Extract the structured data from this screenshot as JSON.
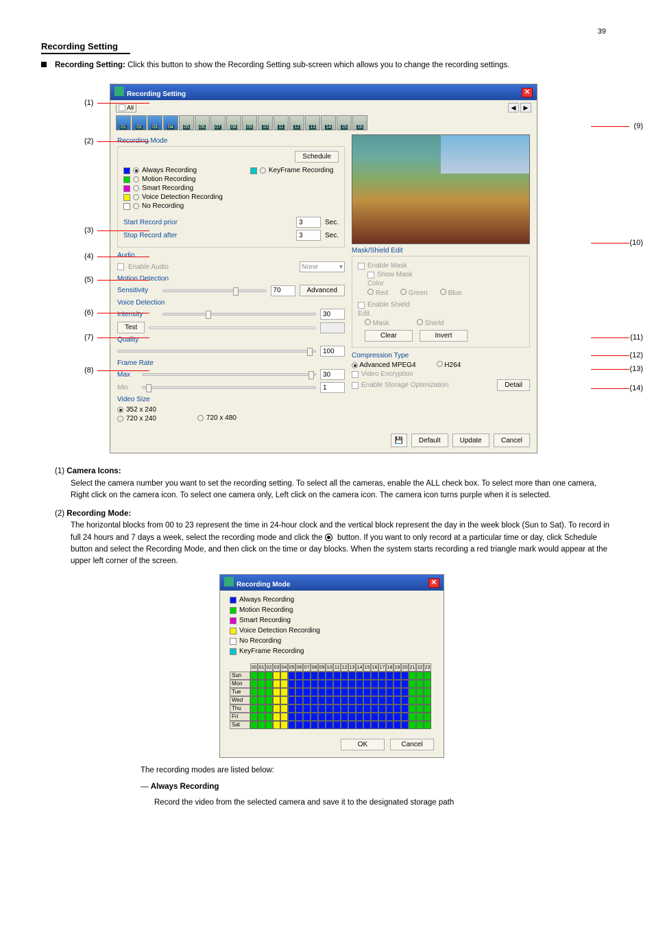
{
  "page_number": "39",
  "heading": "Recording Setting",
  "intro_label": "Recording Setting:",
  "intro_text": "Click this button to show the Recording Setting sub-screen which allows you to change the recording settings.",
  "dialog": {
    "title": "Recording Setting",
    "all": "All",
    "camera_tabs": [
      "01",
      "02",
      "03",
      "04",
      "05",
      "06",
      "07",
      "08",
      "09",
      "10",
      "11",
      "12",
      "13",
      "14",
      "15",
      "16"
    ],
    "recording_mode": {
      "title": "Recording Mode",
      "schedule_btn": "Schedule",
      "options": [
        {
          "label": "Always Recording",
          "color": "#0018f0",
          "checked": true
        },
        {
          "label": "KeyFrame Recording",
          "color": "#00c8c8",
          "checked": false,
          "right": true
        },
        {
          "label": "Motion Recording",
          "color": "#00d000",
          "checked": false
        },
        {
          "label": "Smart Recording",
          "color": "#e000d0",
          "checked": false
        },
        {
          "label": "Voice Detection Recording",
          "color": "#f8f000",
          "checked": false
        },
        {
          "label": "No Recording",
          "color": "#ffffff",
          "checked": false
        }
      ],
      "start_prior_label": "Start Record prior",
      "start_prior_val": "3",
      "sec": "Sec.",
      "stop_after_label": "Stop Record after",
      "stop_after_val": "3"
    },
    "audio": {
      "title": "Audio",
      "enable": "Enable Audio",
      "dropdown": "None"
    },
    "motion": {
      "title": "Motion Detection",
      "sens_label": "Sensitivity",
      "sens_val": "70",
      "adv": "Advanced"
    },
    "voice": {
      "title": "Voice Detection",
      "intensity_label": "Intensity",
      "intensity_val": "30",
      "test": "Test"
    },
    "quality": {
      "title": "Quality",
      "val": "100"
    },
    "framerate": {
      "title": "Frame Rate",
      "max": "Max",
      "max_val": "30",
      "min": "Min",
      "min_val": "1"
    },
    "videosize": {
      "title": "Video Size",
      "o1": "352 x 240",
      "o2": "720 x 240",
      "o3": "720 x 480"
    },
    "maskshield": {
      "title": "Mask/Shield Edit",
      "enable_mask": "Enable Mask",
      "show_mask": "Show Mask",
      "color": "Color",
      "red": "Red",
      "green": "Green",
      "blue": "Blue",
      "enable_shield": "Enable Shield",
      "edit": "Edit",
      "mask": "Mask",
      "shield": "Shield",
      "clear": "Clear",
      "invert": "Invert"
    },
    "compression": {
      "title": "Compression Type",
      "mpeg4": "Advanced MPEG4",
      "h264": "H264",
      "video_enc": "Video Encryption",
      "storage_opt": "Enable Storage Optimization",
      "detail": "Detail"
    },
    "buttons": {
      "default": "Default",
      "update": "Update",
      "cancel": "Cancel"
    }
  },
  "callouts": [
    "(1)",
    "(2)",
    "(3)",
    "(4)",
    "(5)",
    "(6)",
    "(7)",
    "(8)",
    "(9)",
    "(10)",
    "(11)",
    "(12)",
    "(13)",
    "(14)"
  ],
  "section1_num": "(1)",
  "section1_title": "Camera Icons:",
  "section1_text": "Select the camera number you want to set the recording setting. To select all the cameras, enable the ALL check box. To select more than one camera, Right click on the camera icon. To select one camera only, Left click on the camera icon. The camera icon turns purple when it is selected.",
  "section2_num": "(2)",
  "section2_title": "Recording Mode:",
  "section2_text": "The horizontal blocks from 00 to 23 represent the time in 24-hour clock and the vertical block represent the day in the week block (Sun to Sat). To record in full 24 hours and 7 days a week, select the recording mode and click the",
  "section2_text2": "button. If you want to only record at a particular time or day, click Schedule button and select the Recording Mode, and then click on the time or day blocks. When the system starts recording a red triangle mark would appear at the upper left corner of the screen.",
  "sched": {
    "title": "Recording Mode",
    "legend": [
      {
        "label": "Always Recording",
        "color": "#0018f0"
      },
      {
        "label": "Motion Recording",
        "color": "#00d000"
      },
      {
        "label": "Smart Recording",
        "color": "#e000d0"
      },
      {
        "label": "Voice Detection Recording",
        "color": "#f8f000"
      },
      {
        "label": "No Recording",
        "color": "#ffffff"
      },
      {
        "label": "KeyFrame Recording",
        "color": "#00c8c8"
      }
    ],
    "hours": [
      "00",
      "01",
      "02",
      "03",
      "04",
      "05",
      "06",
      "07",
      "08",
      "09",
      "10",
      "11",
      "12",
      "13",
      "14",
      "15",
      "16",
      "17",
      "18",
      "19",
      "20",
      "21",
      "22",
      "23"
    ],
    "days": [
      "Sun",
      "Mon",
      "Tue",
      "Wed",
      "Thu",
      "Fri",
      "Sat"
    ],
    "ok": "OK",
    "cancel": "Cancel"
  },
  "modes_intro": "The recording modes are listed below:",
  "mode_always_title": "Always Recording",
  "mode_always_text": "Record the video from the selected camera and save it to the designated storage path"
}
